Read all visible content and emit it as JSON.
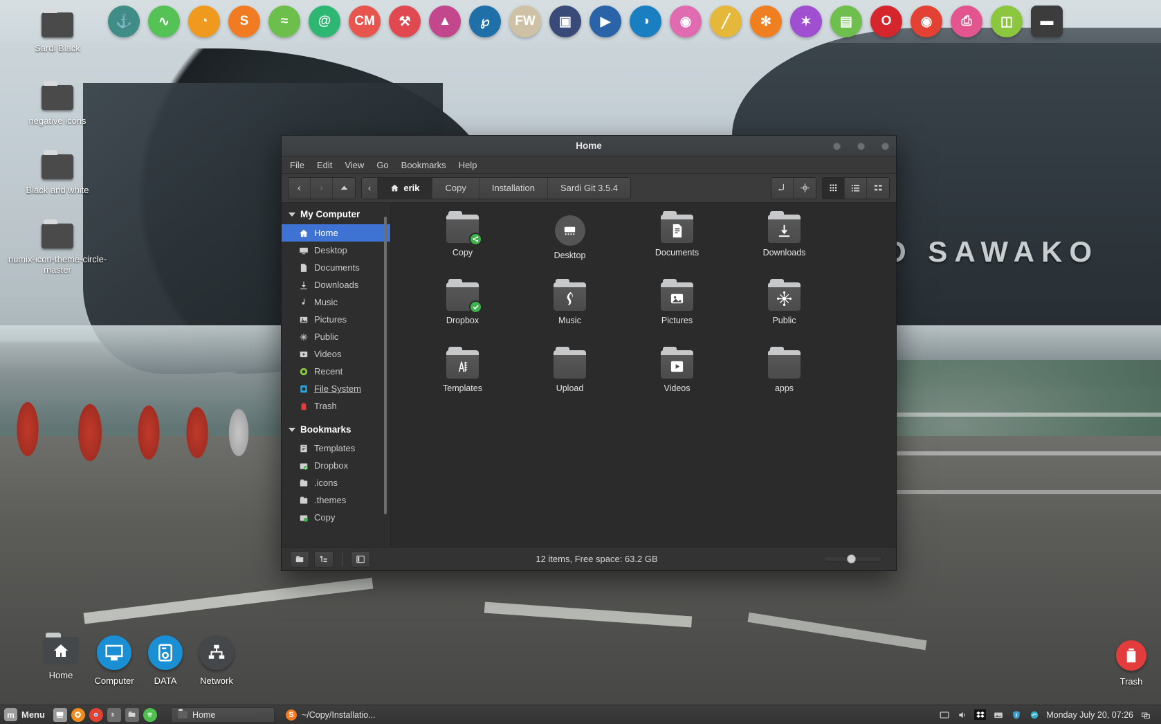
{
  "desktop": {
    "wallpaper_text": "YO SAWAKO",
    "icons": [
      {
        "label": "Sardi Black",
        "icon": "folder-icon"
      },
      {
        "label": "negative icons",
        "icon": "folder-icon"
      },
      {
        "label": "Black and white",
        "icon": "folder-icon"
      },
      {
        "label": "numix-icon-theme-circle-master",
        "icon": "folder-icon"
      }
    ],
    "shortcuts": [
      {
        "label": "Home",
        "icon": "home-folder-icon",
        "color": "#45484a"
      },
      {
        "label": "Computer",
        "icon": "monitor-icon",
        "color": "#1b8fd4"
      },
      {
        "label": "DATA",
        "icon": "drive-icon",
        "color": "#1b8fd4"
      },
      {
        "label": "Network",
        "icon": "network-icon",
        "color": "#4a4a4a"
      }
    ],
    "trash": {
      "label": "Trash",
      "icon": "trash-icon",
      "color": "#e23c3c"
    }
  },
  "dock": {
    "items": [
      {
        "name": "anchor-icon",
        "glyph": "⚓",
        "color": "#3f8d86",
        "shape": "circle"
      },
      {
        "name": "pulse-icon",
        "glyph": "∿",
        "color": "#55c255",
        "shape": "circle"
      },
      {
        "name": "firefox-icon",
        "glyph": "◔",
        "color": "#ef9a1e",
        "shape": "circle"
      },
      {
        "name": "sublime-icon",
        "glyph": "S",
        "color": "#f07b22",
        "shape": "circle"
      },
      {
        "name": "spotify-icon",
        "glyph": "≈",
        "color": "#6cbf4a",
        "shape": "circle"
      },
      {
        "name": "mail-icon",
        "glyph": "@",
        "color": "#2eb673",
        "shape": "circle"
      },
      {
        "name": "cm-icon",
        "glyph": "CM",
        "color": "#e8554e",
        "shape": "circle"
      },
      {
        "name": "tools-icon",
        "glyph": "⚒",
        "color": "#e0494f",
        "shape": "circle"
      },
      {
        "name": "inkscape-icon",
        "glyph": "▲",
        "color": "#c2478c",
        "shape": "circle"
      },
      {
        "name": "audio-mixer-icon",
        "glyph": "℘",
        "color": "#1f6fa8",
        "shape": "circle"
      },
      {
        "name": "fw-icon",
        "glyph": "FW",
        "color": "#cfc1a5",
        "shape": "circle"
      },
      {
        "name": "image-viewer-icon",
        "glyph": "▣",
        "color": "#3a4a78",
        "shape": "circle"
      },
      {
        "name": "video-player-icon",
        "glyph": "▶",
        "color": "#2a63a8",
        "shape": "circle"
      },
      {
        "name": "globe-icon",
        "glyph": "◑",
        "color": "#1a7fc1",
        "shape": "circle"
      },
      {
        "name": "camera-icon",
        "glyph": "◉",
        "color": "#e06bb0",
        "shape": "circle"
      },
      {
        "name": "ruler-icon",
        "glyph": "╱",
        "color": "#e5b73b",
        "shape": "circle"
      },
      {
        "name": "flower-icon",
        "glyph": "✻",
        "color": "#f07f22",
        "shape": "circle"
      },
      {
        "name": "compass-icon",
        "glyph": "✶",
        "color": "#a14fd1",
        "shape": "circle"
      },
      {
        "name": "hardware-icon",
        "glyph": "▤",
        "color": "#6fbf4e",
        "shape": "circle"
      },
      {
        "name": "opera-icon",
        "glyph": "O",
        "color": "#d4262c",
        "shape": "circle"
      },
      {
        "name": "chrome-icon",
        "glyph": "◉",
        "color": "#e34133",
        "shape": "circle"
      },
      {
        "name": "printer-icon",
        "glyph": "⎙",
        "color": "#e2558e",
        "shape": "circle"
      },
      {
        "name": "book-icon",
        "glyph": "◫",
        "color": "#8cc63f",
        "shape": "circle"
      },
      {
        "name": "folder-dock-icon",
        "glyph": "▬",
        "color": "#3c3c3c",
        "shape": "square"
      }
    ]
  },
  "file_manager": {
    "title": "Home",
    "menus": [
      "File",
      "Edit",
      "View",
      "Go",
      "Bookmarks",
      "Help"
    ],
    "nav": {
      "back": "‹",
      "forward": "›",
      "up": "^",
      "pathback": "‹"
    },
    "breadcrumbs": [
      {
        "label": "erik",
        "current": true,
        "icon": "home-icon"
      },
      {
        "label": "Copy",
        "current": false
      },
      {
        "label": "Installation",
        "current": false
      },
      {
        "label": "Sardi Git 3.5.4",
        "current": false
      }
    ],
    "toolbar_right": [
      {
        "name": "open-terminal-icon"
      },
      {
        "name": "location-icon"
      }
    ],
    "view_modes": [
      {
        "name": "icon-view-button",
        "active": true
      },
      {
        "name": "list-view-button",
        "active": false
      },
      {
        "name": "compact-view-button",
        "active": false
      }
    ],
    "sidebar": {
      "sections": [
        {
          "title": "My Computer",
          "items": [
            {
              "label": "Home",
              "icon": "home-icon",
              "selected": true,
              "color": "#ffffff"
            },
            {
              "label": "Desktop",
              "icon": "desktop-icon",
              "selected": false,
              "color": "#cfcfcf"
            },
            {
              "label": "Documents",
              "icon": "documents-icon",
              "selected": false,
              "color": "#cfcfcf"
            },
            {
              "label": "Downloads",
              "icon": "downloads-icon",
              "selected": false,
              "color": "#cfcfcf"
            },
            {
              "label": "Music",
              "icon": "music-icon",
              "selected": false,
              "color": "#cfcfcf"
            },
            {
              "label": "Pictures",
              "icon": "pictures-icon",
              "selected": false,
              "color": "#cfcfcf"
            },
            {
              "label": "Public",
              "icon": "public-icon",
              "selected": false,
              "color": "#cfcfcf"
            },
            {
              "label": "Videos",
              "icon": "videos-icon",
              "selected": false,
              "color": "#cfcfcf"
            },
            {
              "label": "Recent",
              "icon": "recent-icon",
              "selected": false,
              "color": "#8cc63f"
            },
            {
              "label": "File System",
              "icon": "filesystem-icon",
              "selected": false,
              "color": "#2ba8e0",
              "link": true
            },
            {
              "label": "Trash",
              "icon": "trash-icon",
              "selected": false,
              "color": "#e23c3c"
            }
          ]
        },
        {
          "title": "Bookmarks",
          "items": [
            {
              "label": "Templates",
              "icon": "templates-icon",
              "selected": false,
              "color": "#cfcfcf"
            },
            {
              "label": "Dropbox",
              "icon": "dropbox-folder-icon",
              "selected": false,
              "color": "#cfcfcf"
            },
            {
              "label": ".icons",
              "icon": "folder-icon",
              "selected": false,
              "color": "#cfcfcf"
            },
            {
              "label": ".themes",
              "icon": "folder-icon",
              "selected": false,
              "color": "#cfcfcf"
            },
            {
              "label": "Copy",
              "icon": "copy-folder-icon",
              "selected": false,
              "color": "#cfcfcf"
            }
          ]
        }
      ]
    },
    "files": [
      {
        "label": "Copy",
        "icon": "folder-share-icon",
        "badge": "share",
        "badge_color": "#3eb34a",
        "round": false
      },
      {
        "label": "Desktop",
        "icon": "desktop-icon",
        "badge": null,
        "round": true
      },
      {
        "label": "Documents",
        "icon": "document-icon",
        "badge": null,
        "round": false
      },
      {
        "label": "Downloads",
        "icon": "download-icon",
        "badge": null,
        "round": false
      },
      {
        "label": "Dropbox",
        "icon": "folder-icon",
        "badge": "check",
        "badge_color": "#3eb34a",
        "round": false
      },
      {
        "label": "Music",
        "icon": "note-icon",
        "badge": null,
        "round": false
      },
      {
        "label": "Pictures",
        "icon": "image-icon",
        "badge": null,
        "round": false
      },
      {
        "label": "Public",
        "icon": "share-nodes-icon",
        "badge": null,
        "round": false
      },
      {
        "label": "Templates",
        "icon": "templates-icon",
        "badge": null,
        "round": false
      },
      {
        "label": "Upload",
        "icon": "plain-folder-icon",
        "badge": null,
        "round": false
      },
      {
        "label": "Videos",
        "icon": "play-icon",
        "badge": null,
        "round": false
      },
      {
        "label": "apps",
        "icon": "plain-folder-icon",
        "badge": null,
        "round": false
      }
    ],
    "statusbar": {
      "text": "12 items, Free space: 63.2 GB",
      "buttons": [
        {
          "name": "show-hidden-button"
        },
        {
          "name": "tree-view-button"
        },
        {
          "name": "toggle-sidebar-button"
        }
      ],
      "zoom_percent": 46
    }
  },
  "taskbar": {
    "menu_label": "Menu",
    "launchers": [
      {
        "name": "terminal-launcher-icon",
        "color": "#9a9a9a"
      },
      {
        "name": "firefox-launcher-icon",
        "color": "#ef8c1e"
      },
      {
        "name": "chrome-launcher-icon",
        "color": "#e34133"
      },
      {
        "name": "shell-launcher-icon",
        "color": "#6d6d6d"
      },
      {
        "name": "files-launcher-icon",
        "color": "#6a6a6a"
      },
      {
        "name": "spotify-launcher-icon",
        "color": "#4fc04f"
      }
    ],
    "windows": [
      {
        "label": "Home",
        "icon": "folder-icon",
        "active": true
      },
      {
        "label": "~/Copy/Installatio...",
        "icon": "sublime-icon",
        "active": false
      }
    ],
    "tray": [
      {
        "name": "terminal-tray-icon",
        "color": "#b9b9b9"
      },
      {
        "name": "volume-tray-icon",
        "color": "#d8d8d8"
      },
      {
        "name": "dropbox-tray-icon",
        "color": "#ffffff"
      },
      {
        "name": "wallpaper-tray-icon",
        "color": "#c9c9c9"
      },
      {
        "name": "shield-tray-icon",
        "color": "#3f9fd0"
      },
      {
        "name": "update-tray-icon",
        "color": "#39b0c9"
      }
    ],
    "clock": "Monday July 20, 07:26",
    "show_desktop": "show-desktop-button"
  }
}
